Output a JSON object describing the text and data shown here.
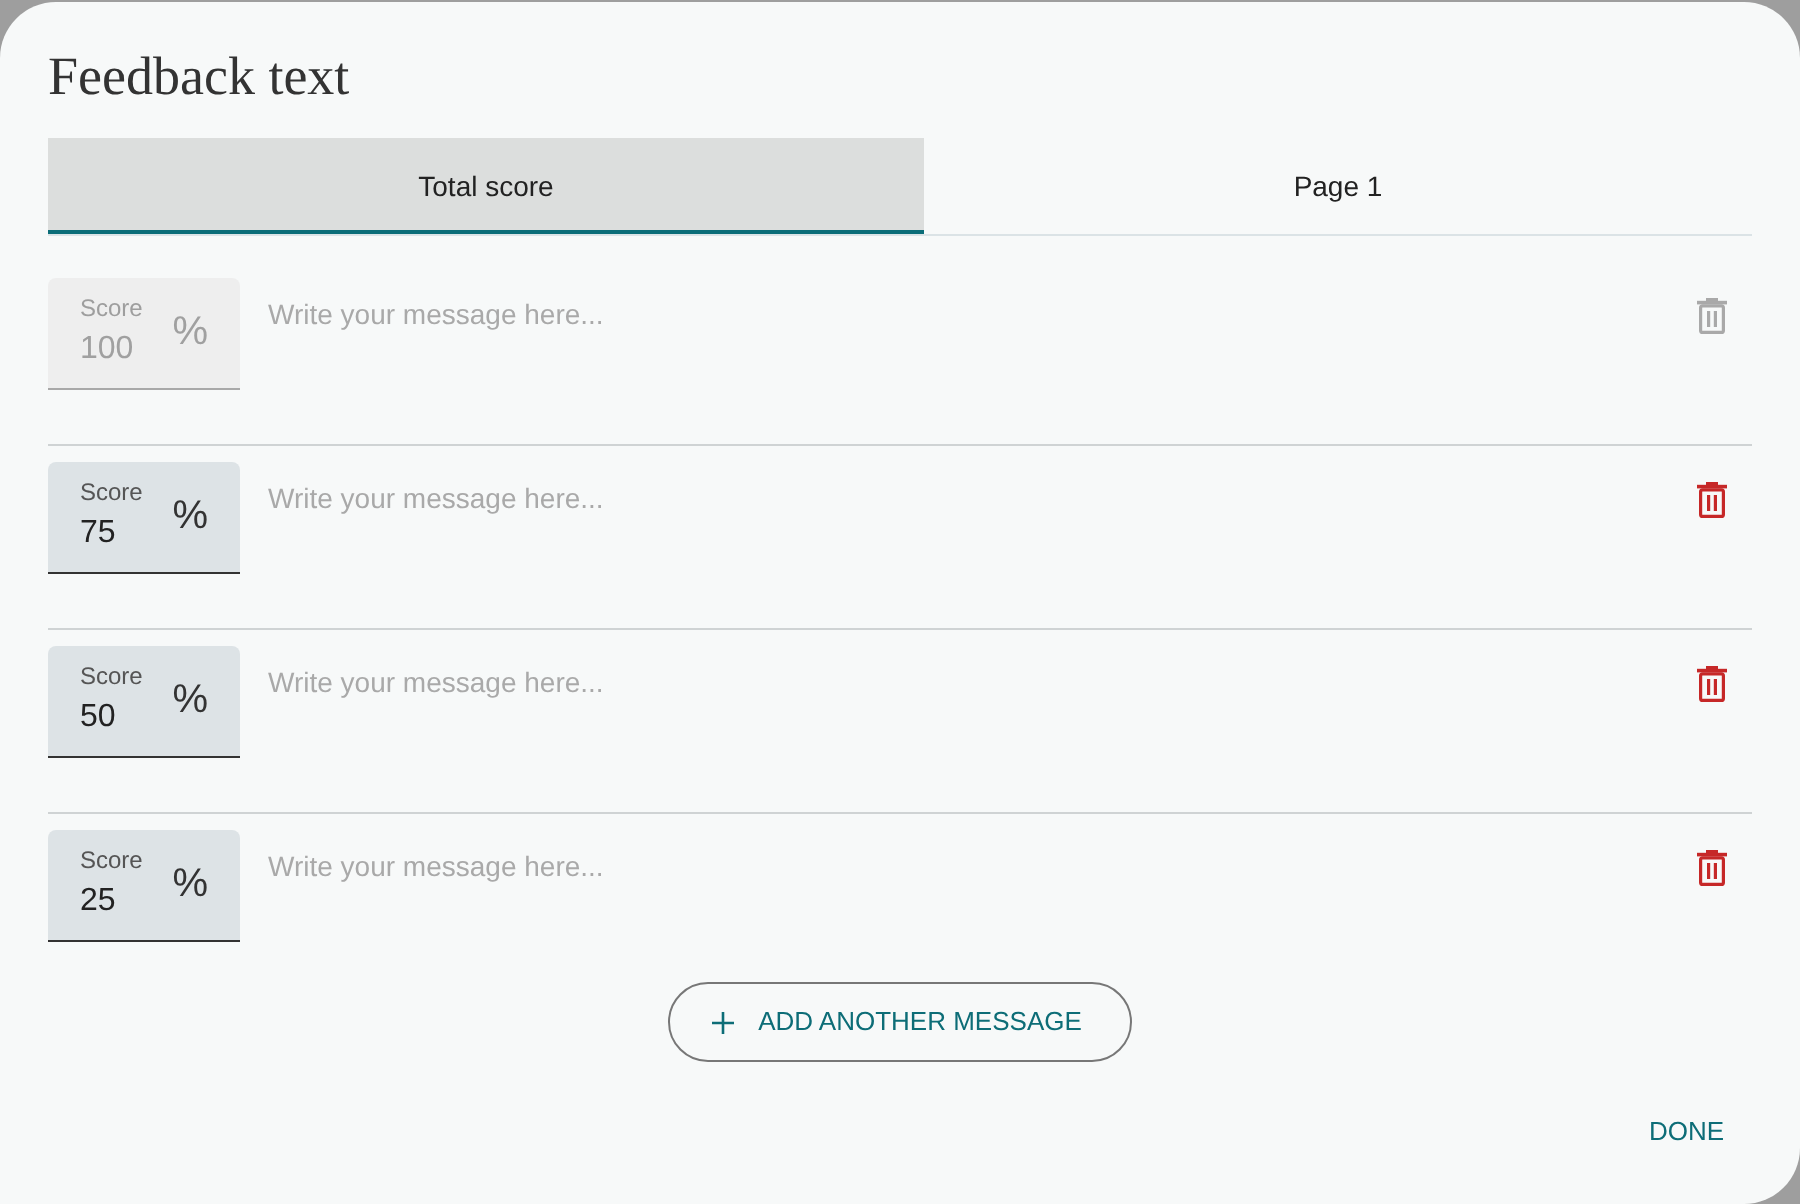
{
  "dialog": {
    "title": "Feedback text"
  },
  "tabs": [
    {
      "label": "Total score",
      "selected": true
    },
    {
      "label": "Page 1",
      "selected": false
    }
  ],
  "messages": [
    {
      "score_label": "Score",
      "score": "100",
      "unit": "%",
      "placeholder": "Write your message here...",
      "disabled": true
    },
    {
      "score_label": "Score",
      "score": "75",
      "unit": "%",
      "placeholder": "Write your message here...",
      "disabled": false
    },
    {
      "score_label": "Score",
      "score": "50",
      "unit": "%",
      "placeholder": "Write your message here...",
      "disabled": false
    },
    {
      "score_label": "Score",
      "score": "25",
      "unit": "%",
      "placeholder": "Write your message here...",
      "disabled": false
    }
  ],
  "add_button": {
    "label": "ADD ANOTHER MESSAGE"
  },
  "done_button": {
    "label": "DONE"
  }
}
